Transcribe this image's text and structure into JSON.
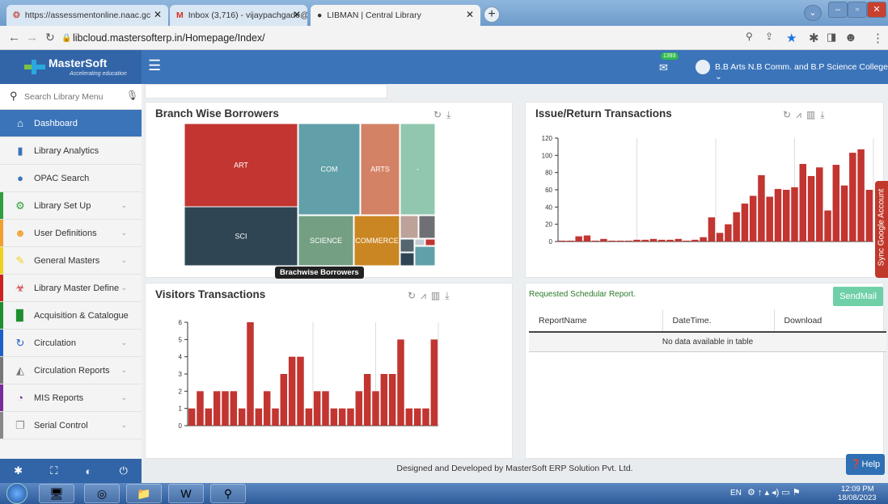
{
  "browser": {
    "tabs": [
      {
        "title": "https://assessmentonline.naac.gc"
      },
      {
        "title": "Inbox (3,716) - vijaypachgade@g"
      },
      {
        "title": "LIBMAN | Central Library"
      }
    ],
    "url": "libcloud.mastersofterp.in/Homepage/Index/"
  },
  "brand": {
    "name": "MasterSoft",
    "tagline": "Accelerating education"
  },
  "header": {
    "badge": "1393",
    "college": "B.B Arts N.B Comm. and B.P Science College ⌄"
  },
  "sidebar": {
    "search_placeholder": "Search Library Menu",
    "items": [
      {
        "label": "Dashboard",
        "icon": "home-icon",
        "active": true,
        "color": "#3b74b9"
      },
      {
        "label": "Library Analytics",
        "icon": "bar-chart-icon",
        "color": "#3b74b9"
      },
      {
        "label": "OPAC Search",
        "icon": "globe-icon",
        "color": "#3b74b9"
      },
      {
        "label": "Library Set Up",
        "icon": "cogs-icon",
        "color": "#2e9e3e"
      },
      {
        "label": "User Definitions",
        "icon": "users-icon",
        "color": "#f0a030"
      },
      {
        "label": "General Masters",
        "icon": "edit-icon",
        "color": "#f0d020"
      },
      {
        "label": "Library Master Define",
        "icon": "biohazard-icon",
        "color": "#cc2222"
      },
      {
        "label": "Acquisition & Catalogue",
        "icon": "book-icon",
        "color": "#1e8e2e"
      },
      {
        "label": "Circulation",
        "icon": "refresh-icon",
        "color": "#1f5fc8"
      },
      {
        "label": "Circulation Reports",
        "icon": "area-chart-icon",
        "color": "#777777"
      },
      {
        "label": "MIS Reports",
        "icon": "pie-chart-icon",
        "color": "#7a2a9a"
      },
      {
        "label": "Serial Control",
        "icon": "clone-icon",
        "color": "#888888"
      }
    ]
  },
  "panels": {
    "branch": {
      "title": "Branch Wise Borrowers",
      "tooltip": "Brachwise Borrowers"
    },
    "issue": {
      "title": "Issue/Return Transactions"
    },
    "visitors": {
      "title": "Visitors Transactions"
    },
    "report": {
      "title": "Requested Schedular Report.",
      "send_label": "SendMail",
      "columns": [
        "ReportName",
        "DateTime.",
        "Download"
      ],
      "empty": "No data available in table"
    }
  },
  "sync_label": "Sync Google Account",
  "help_label": "Help",
  "footer": "Designed and Developed by MasterSoft ERP Solution Pvt. Ltd.",
  "taskbar": {
    "lang": "EN",
    "time": "12:09 PM",
    "date": "18/08/2023"
  },
  "chart_data": [
    {
      "type": "treemap",
      "title": "Branch Wise Borrowers",
      "categories": [
        "ART",
        "SCI",
        "COM",
        "ARTS",
        "-",
        "SCIENCE",
        "COMMERCE"
      ],
      "colors": [
        "#c23531",
        "#2f4554",
        "#61a0a8",
        "#d48265",
        "#91c7ae",
        "#749f83",
        "#ca8622"
      ]
    },
    {
      "type": "bar",
      "title": "Issue/Return Transactions",
      "ylim": [
        0,
        120
      ],
      "yticks": [
        0,
        20,
        40,
        60,
        80,
        100,
        120
      ],
      "values": [
        1,
        1,
        6,
        7,
        1,
        3,
        1,
        1,
        1,
        2,
        2,
        3,
        2,
        2,
        3,
        1,
        2,
        5,
        28,
        10,
        20,
        34,
        44,
        53,
        77,
        52,
        61,
        60,
        63,
        90,
        76,
        86,
        36,
        89,
        65,
        103,
        107,
        60
      ],
      "color": "#c23531"
    },
    {
      "type": "bar",
      "title": "Visitors Transactions",
      "ylim": [
        0,
        6
      ],
      "yticks": [
        0,
        1,
        2,
        3,
        4,
        5,
        6
      ],
      "values": [
        1,
        2,
        1,
        2,
        2,
        2,
        1,
        6,
        1,
        2,
        1,
        3,
        4,
        4,
        1,
        2,
        2,
        1,
        1,
        1,
        2,
        3,
        2,
        3,
        3,
        5,
        1,
        1,
        1,
        5
      ],
      "color": "#c23531"
    }
  ]
}
